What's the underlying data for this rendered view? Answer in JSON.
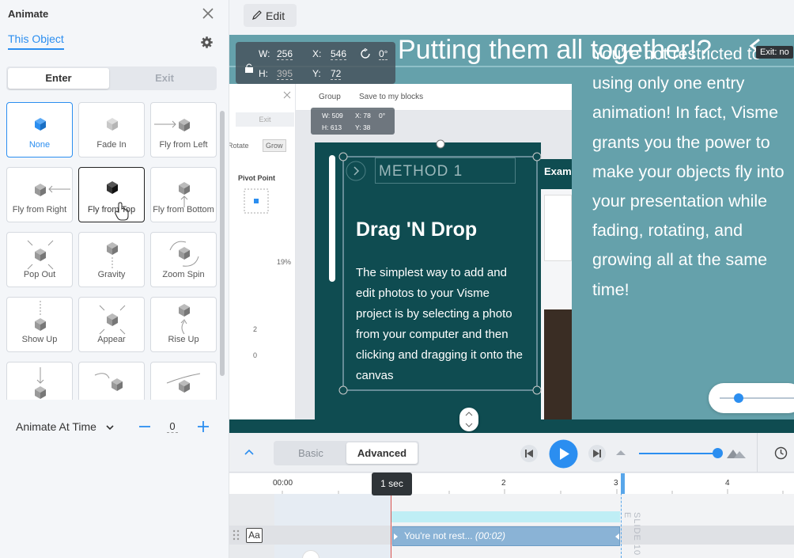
{
  "panel": {
    "title": "Animate",
    "tab_label": "This Object",
    "enter_label": "Enter",
    "exit_label": "Exit",
    "animations": [
      {
        "label": "None",
        "selected": true
      },
      {
        "label": "Fade In"
      },
      {
        "label": "Fly from Left"
      },
      {
        "label": "Fly from Right"
      },
      {
        "label": "Fly from Top",
        "hovered": true
      },
      {
        "label": "Fly from Bottom"
      },
      {
        "label": "Pop Out"
      },
      {
        "label": "Gravity"
      },
      {
        "label": "Zoom Spin"
      },
      {
        "label": "Show Up"
      },
      {
        "label": "Appear"
      },
      {
        "label": "Rise Up"
      }
    ],
    "animate_mode": "Animate At Time",
    "time_value": "0"
  },
  "toolbar": {
    "edit_label": "Edit"
  },
  "canvas": {
    "title": "Putting them all together!?",
    "body_text": "You're not restricted to using only one entry animation! In fact, Visme grants you the power to make your objects fly into your presentation while fading, rotating, and growing all at the same time!",
    "exit_tag": "Exit: no",
    "dims": {
      "w_label": "W:",
      "w": "256",
      "h_label": "H:",
      "h": "395",
      "x_label": "X:",
      "x": "546",
      "y_label": "Y:",
      "y": "72",
      "rotation": "0°"
    },
    "inner_shot": {
      "top_items": [
        "Group",
        "Save to my blocks"
      ],
      "side_exit": "Exit",
      "chips": [
        "Rotate",
        "Grow"
      ],
      "pivot_label": "Pivot Point",
      "pct": "19%",
      "num_a": "2",
      "num_b": "0",
      "inner_dims": {
        "w": "509",
        "x": "78",
        "h": "613",
        "y": "38",
        "rot": "0°"
      },
      "method": "METHOD 1",
      "heading": "Drag 'N Drop",
      "paragraph": "The simplest way to add and edit photos to your Visme project is by selecting a photo from your computer and then clicking and dragging it onto the canvas",
      "right_peek": "Exam"
    }
  },
  "timeline": {
    "basic_label": "Basic",
    "advanced_label": "Advanced",
    "ticks": [
      "00:00",
      "1",
      "2",
      "3",
      "4"
    ],
    "tooltip": "1 sec",
    "clip_label": "You're not rest...",
    "clip_time": "(00:02)",
    "slide_end_label": "SLIDE 10 E",
    "track_icon": "Aa"
  },
  "colors": {
    "accent": "#2b8ef0",
    "slide_dark": "#0f4c51",
    "slide_teal": "#65a1ab"
  }
}
